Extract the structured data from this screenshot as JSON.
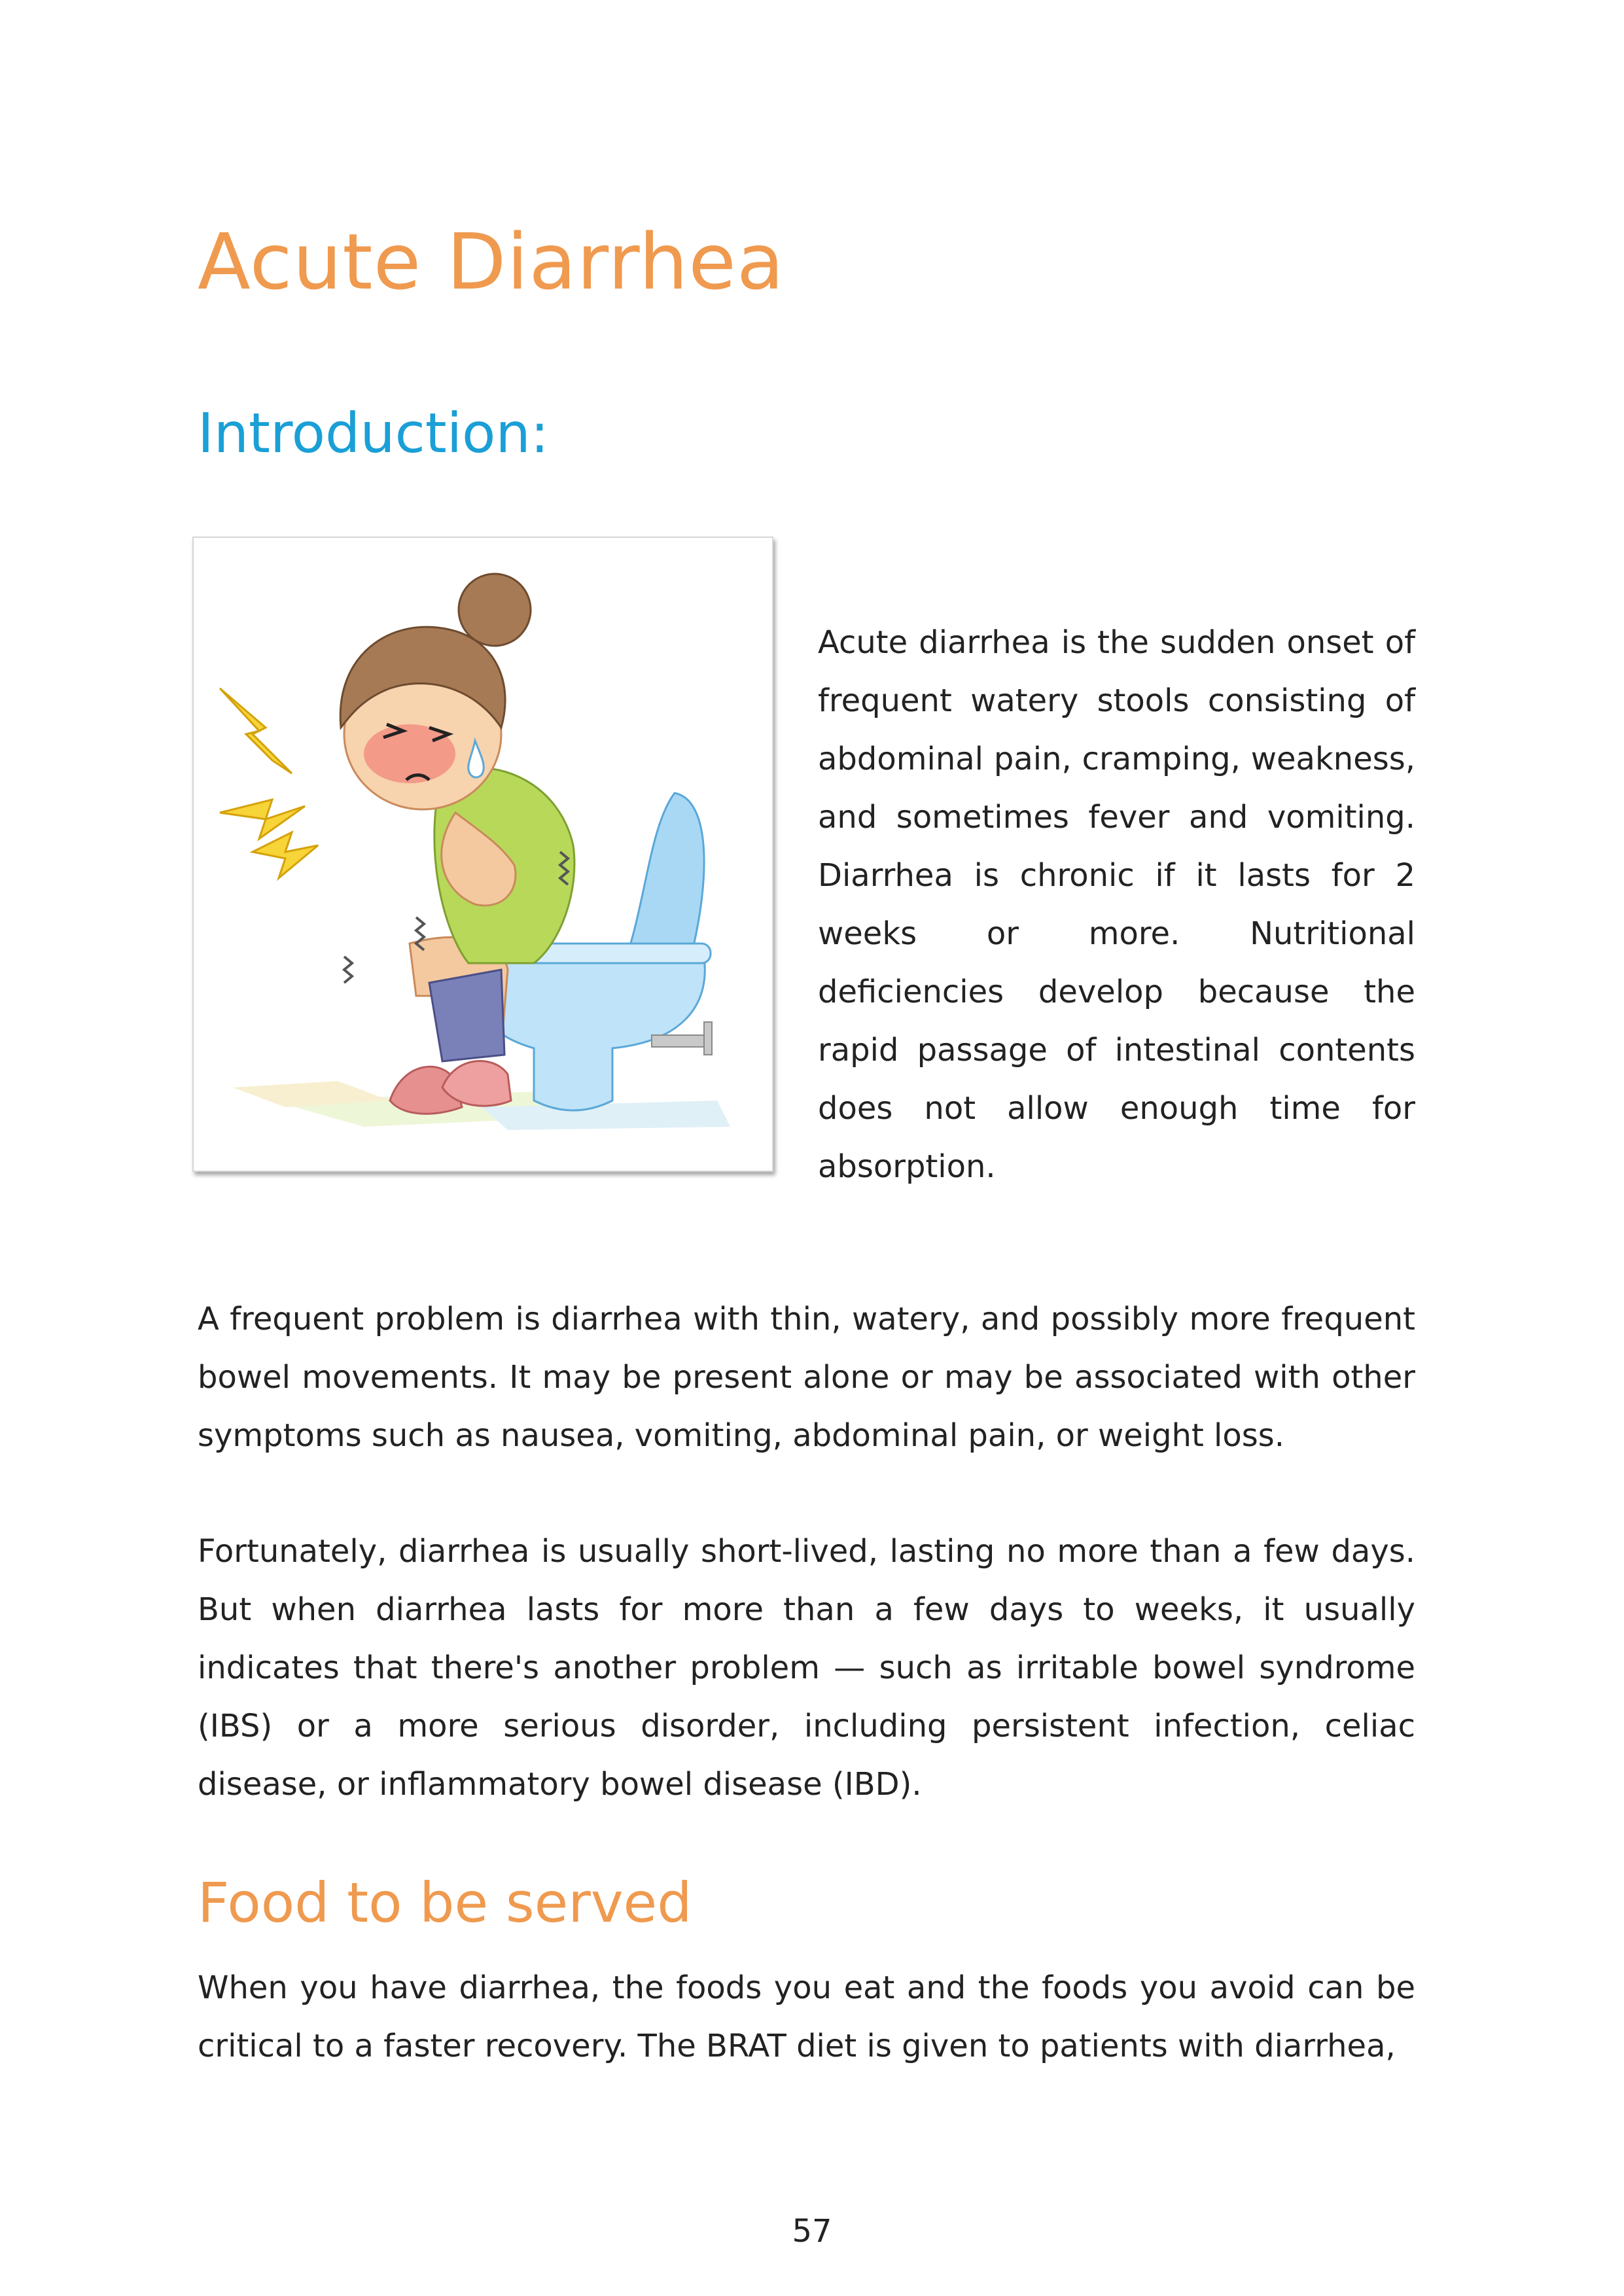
{
  "document": {
    "title": "Acute Diarrhea",
    "intro_heading": "Introduction:",
    "intro_text": "Acute diarrhea is the sudden onset of frequent watery stools consisting of abdominal pain, cramping, weakness, and sometimes fever and vomiting. Diarrhea is chronic if it lasts for 2 weeks or more. Nutritional deficiencies develop because the rapid passage of intestinal contents does not allow enough time for absorption.",
    "paragraph_1": "A frequent problem is diarrhea with thin, watery, and possibly more frequent bowel movements. It may be present alone or may be associated with other symptoms such as nausea, vomiting, abdominal pain, or weight loss.",
    "paragraph_2": "Fortunately, diarrhea is usually short-lived, lasting no more than a few days. But when diarrhea lasts for more than a few days to weeks, it usually indicates that there's another problem — such as irritable bowel syndrome (IBS) or a more serious disorder, including persistent infection, celiac disease, or inflammatory bowel disease (IBD).",
    "food_heading": "Food to be served",
    "paragraph_3": "When you have diarrhea, the foods you eat and the foods you avoid can be critical to a faster recovery. The BRAT diet is given to patients with diarrhea,",
    "page_number": "57"
  },
  "colors": {
    "title": "#ef9a4f",
    "intro_heading": "#1a9fd6",
    "food_heading": "#ef9a4f",
    "body_text": "#222222"
  },
  "illustration": {
    "icon": "person-on-toilet-illustration"
  }
}
